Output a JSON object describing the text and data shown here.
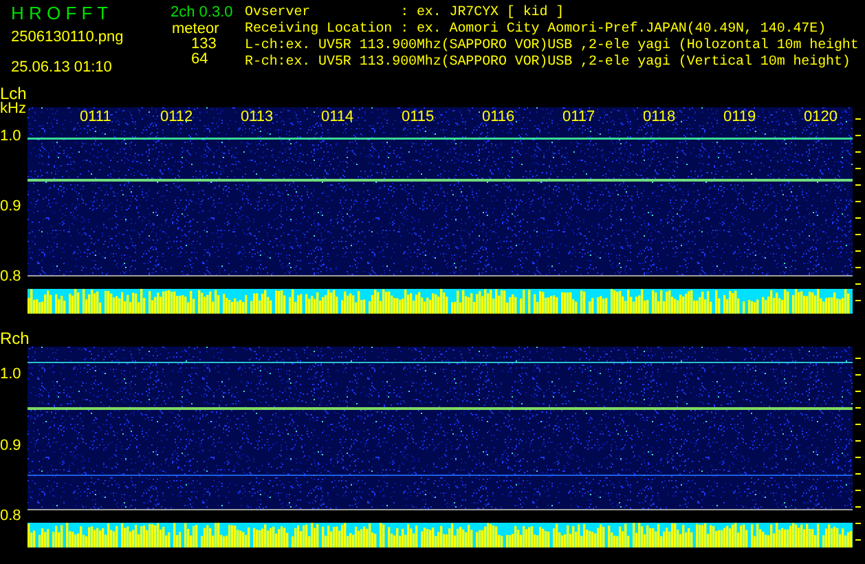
{
  "app": {
    "title": "H R O F F T",
    "version": "2ch 0.3.0",
    "filename": "2506130110.png",
    "datetime": "25.06.13 01:10"
  },
  "meteor": {
    "label": "meteor",
    "counts": [
      "133",
      "64"
    ]
  },
  "info_lines": [
    "Ovserver           : ex. JR7CYX [ kid ]",
    "Receiving Location : ex. Aomori City Aomori-Pref.JAPAN(40.49N, 140.47E)",
    "L-ch:ex. UV5R 113.900Mhz(SAPPORO VOR)USB ,2-ele yagi (Holozontal 10m height",
    "R-ch:ex. UV5R 113.900Mhz(SAPPORO VOR)USB ,2-ele yagi (Vertical 10m height)"
  ],
  "channels": [
    {
      "label": "Lch",
      "unit": "kHz",
      "time_labels": [
        "0111",
        "0112",
        "0113",
        "0114",
        "0115",
        "0116",
        "0117",
        "0118",
        "0119",
        "0120"
      ],
      "freq_labels": [
        "1.0",
        "0.9",
        "0.8"
      ]
    },
    {
      "label": "Rch",
      "freq_labels": [
        "1.0",
        "0.9",
        "0.8"
      ]
    }
  ]
}
